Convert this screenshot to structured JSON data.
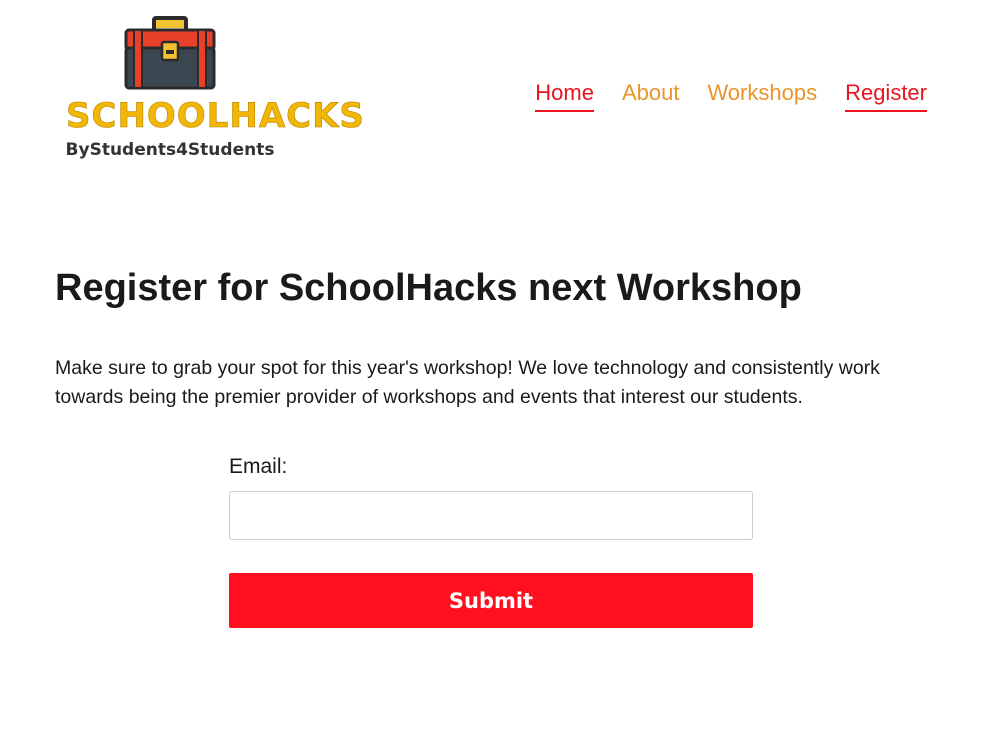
{
  "logo": {
    "wordmark": "SCHOOLHACKS",
    "tagline": "ByStudents4Students",
    "icon": "toolbox-icon",
    "colors": {
      "wordmark": "#f2b705",
      "toolbox_red": "#e8402a",
      "toolbox_dark": "#3a4750",
      "handle_yellow": "#f2c230"
    }
  },
  "nav": {
    "items": [
      {
        "label": "Home",
        "active": true
      },
      {
        "label": "About",
        "active": false
      },
      {
        "label": "Workshops",
        "active": false
      },
      {
        "label": "Register",
        "active": true
      }
    ],
    "colors": {
      "active": "#e8141e",
      "inactive": "#e8962a"
    }
  },
  "main": {
    "title": "Register for SchoolHacks next Workshop",
    "intro": "Make sure to grab your spot for this year's workshop! We love technology and consistently work towards being the premier provider of workshops and events that interest our students."
  },
  "form": {
    "email_label": "Email:",
    "email_value": "",
    "email_placeholder": "",
    "submit_label": "Submit",
    "submit_color": "#ff101e"
  }
}
